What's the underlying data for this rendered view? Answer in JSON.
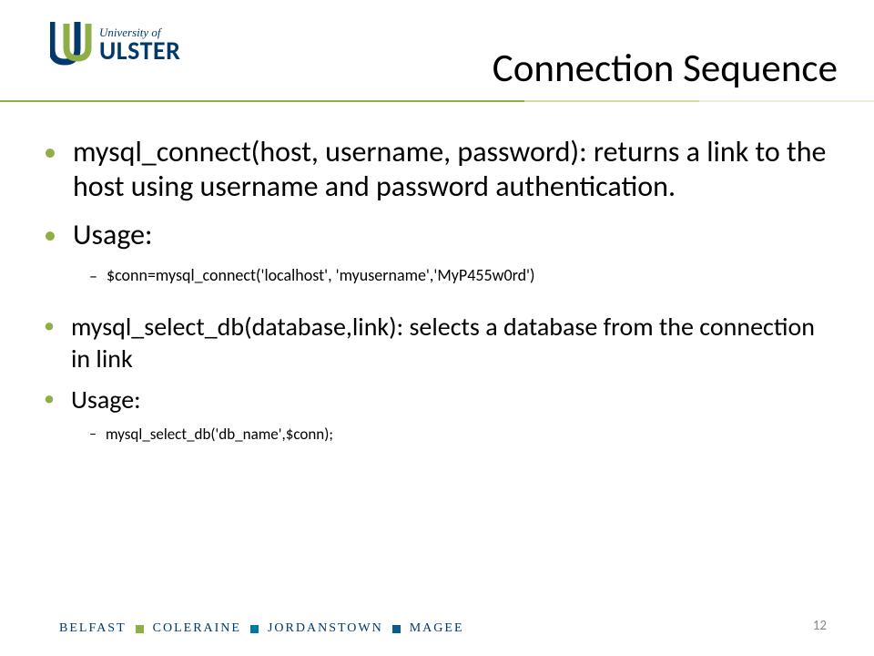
{
  "logo": {
    "line1": "University of",
    "line2": "ULSTER"
  },
  "title": "Connection Sequence",
  "bullets": {
    "b1": "mysql_connect(host, username, password): returns a link to the host using username and password authentication.",
    "b2": "Usage:",
    "b2_sub": "$conn=mysql_connect('localhost', 'myusername','MyP455w0rd')",
    "b3": "mysql_select_db(database,link):   selects a database from the connection in link",
    "b4": "Usage:",
    "b4_sub": "mysql_select_db('db_name',$conn);"
  },
  "footer": {
    "c1": "BELFAST",
    "c2": "COLERAINE",
    "c3": "JORDANSTOWN",
    "c4": "MAGEE"
  },
  "page_number": "12"
}
